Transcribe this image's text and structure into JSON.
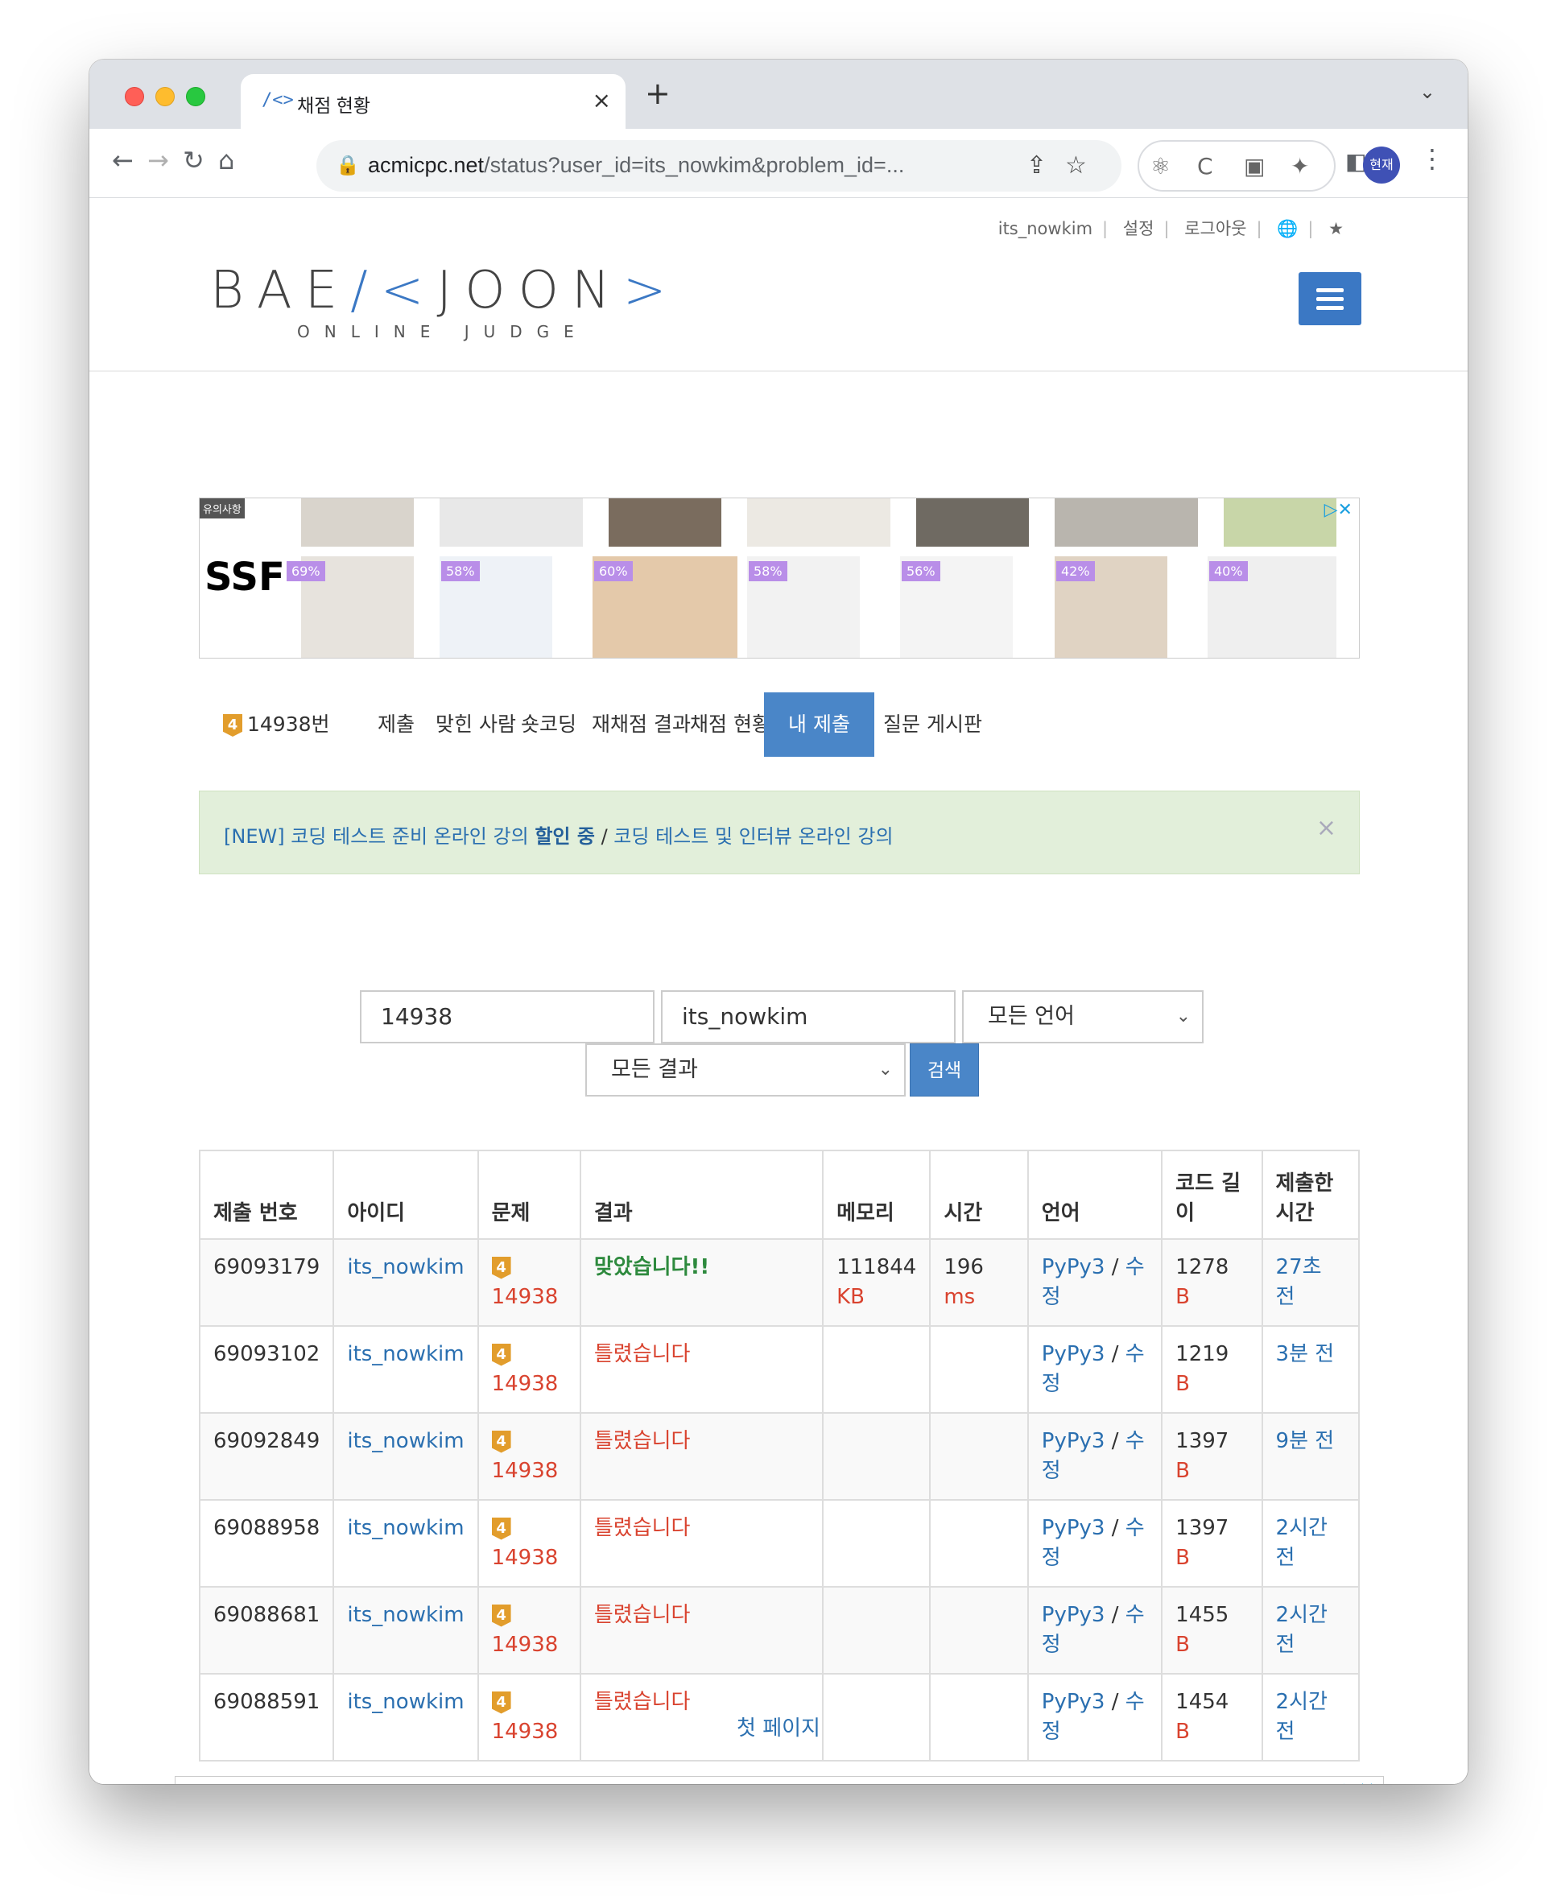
{
  "browser": {
    "tab_title": "채점 현황",
    "tab_favicon": "/<>",
    "url_host": "acmicpc.net",
    "url_path": "/status?user_id=its_nowkim&problem_id=...",
    "profile_label": "현재"
  },
  "site": {
    "top_links": [
      "its_nowkim",
      "설정",
      "로그아웃"
    ],
    "logo_text": "BAEKJOON",
    "logo_sub": "ONLINE JUDGE"
  },
  "ad": {
    "note": "유의사항",
    "brand": "SSF",
    "discounts": [
      "69%",
      "58%",
      "60%",
      "58%",
      "56%",
      "42%",
      "40%"
    ]
  },
  "menu": {
    "problem_level": "4",
    "items": [
      "14938번",
      "제출",
      "맞힌 사람",
      "숏코딩",
      "재채점 결과",
      "채점 현황",
      "내 제출",
      "질문 게시판"
    ],
    "active_index": 6
  },
  "alert": {
    "part1": "[NEW] 코딩 테스트 준비 온라인 강의",
    "bold": "할인 중",
    "slash": " / ",
    "part2": "코딩 테스트 및 인터뷰 온라인 강의",
    "close": "×"
  },
  "search": {
    "problem_id": "14938",
    "user_id": "its_nowkim",
    "language": "모든 언어",
    "result": "모든 결과",
    "button": "검색"
  },
  "table": {
    "headers": [
      "제출 번호",
      "아이디",
      "문제",
      "결과",
      "메모리",
      "시간",
      "언어",
      "코드 길이",
      "제출한 시간"
    ],
    "rows": [
      {
        "id": "69093179",
        "user": "its_nowkim",
        "problem": "14938",
        "result": "맞았습니다!!",
        "ok": true,
        "memory": "111844",
        "memory_unit": "KB",
        "time": "196",
        "time_unit": "ms",
        "lang": "PyPy3",
        "edit": "수정",
        "length": "1278",
        "length_unit": "B",
        "when": "27초 전"
      },
      {
        "id": "69093102",
        "user": "its_nowkim",
        "problem": "14938",
        "result": "틀렸습니다",
        "ok": false,
        "memory": "",
        "memory_unit": "",
        "time": "",
        "time_unit": "",
        "lang": "PyPy3",
        "edit": "수정",
        "length": "1219",
        "length_unit": "B",
        "when": "3분 전"
      },
      {
        "id": "69092849",
        "user": "its_nowkim",
        "problem": "14938",
        "result": "틀렸습니다",
        "ok": false,
        "memory": "",
        "memory_unit": "",
        "time": "",
        "time_unit": "",
        "lang": "PyPy3",
        "edit": "수정",
        "length": "1397",
        "length_unit": "B",
        "when": "9분 전"
      },
      {
        "id": "69088958",
        "user": "its_nowkim",
        "problem": "14938",
        "result": "틀렸습니다",
        "ok": false,
        "memory": "",
        "memory_unit": "",
        "time": "",
        "time_unit": "",
        "lang": "PyPy3",
        "edit": "수정",
        "length": "1397",
        "length_unit": "B",
        "when": "2시간 전"
      },
      {
        "id": "69088681",
        "user": "its_nowkim",
        "problem": "14938",
        "result": "틀렸습니다",
        "ok": false,
        "memory": "",
        "memory_unit": "",
        "time": "",
        "time_unit": "",
        "lang": "PyPy3",
        "edit": "수정",
        "length": "1455",
        "length_unit": "B",
        "when": "2시간 전"
      },
      {
        "id": "69088591",
        "user": "its_nowkim",
        "problem": "14938",
        "result": "틀렸습니다",
        "ok": false,
        "memory": "",
        "memory_unit": "",
        "time": "",
        "time_unit": "",
        "lang": "PyPy3",
        "edit": "수정",
        "length": "1454",
        "length_unit": "B",
        "when": "2시간 전"
      }
    ]
  },
  "pager": {
    "first_page": "첫 페이지"
  }
}
